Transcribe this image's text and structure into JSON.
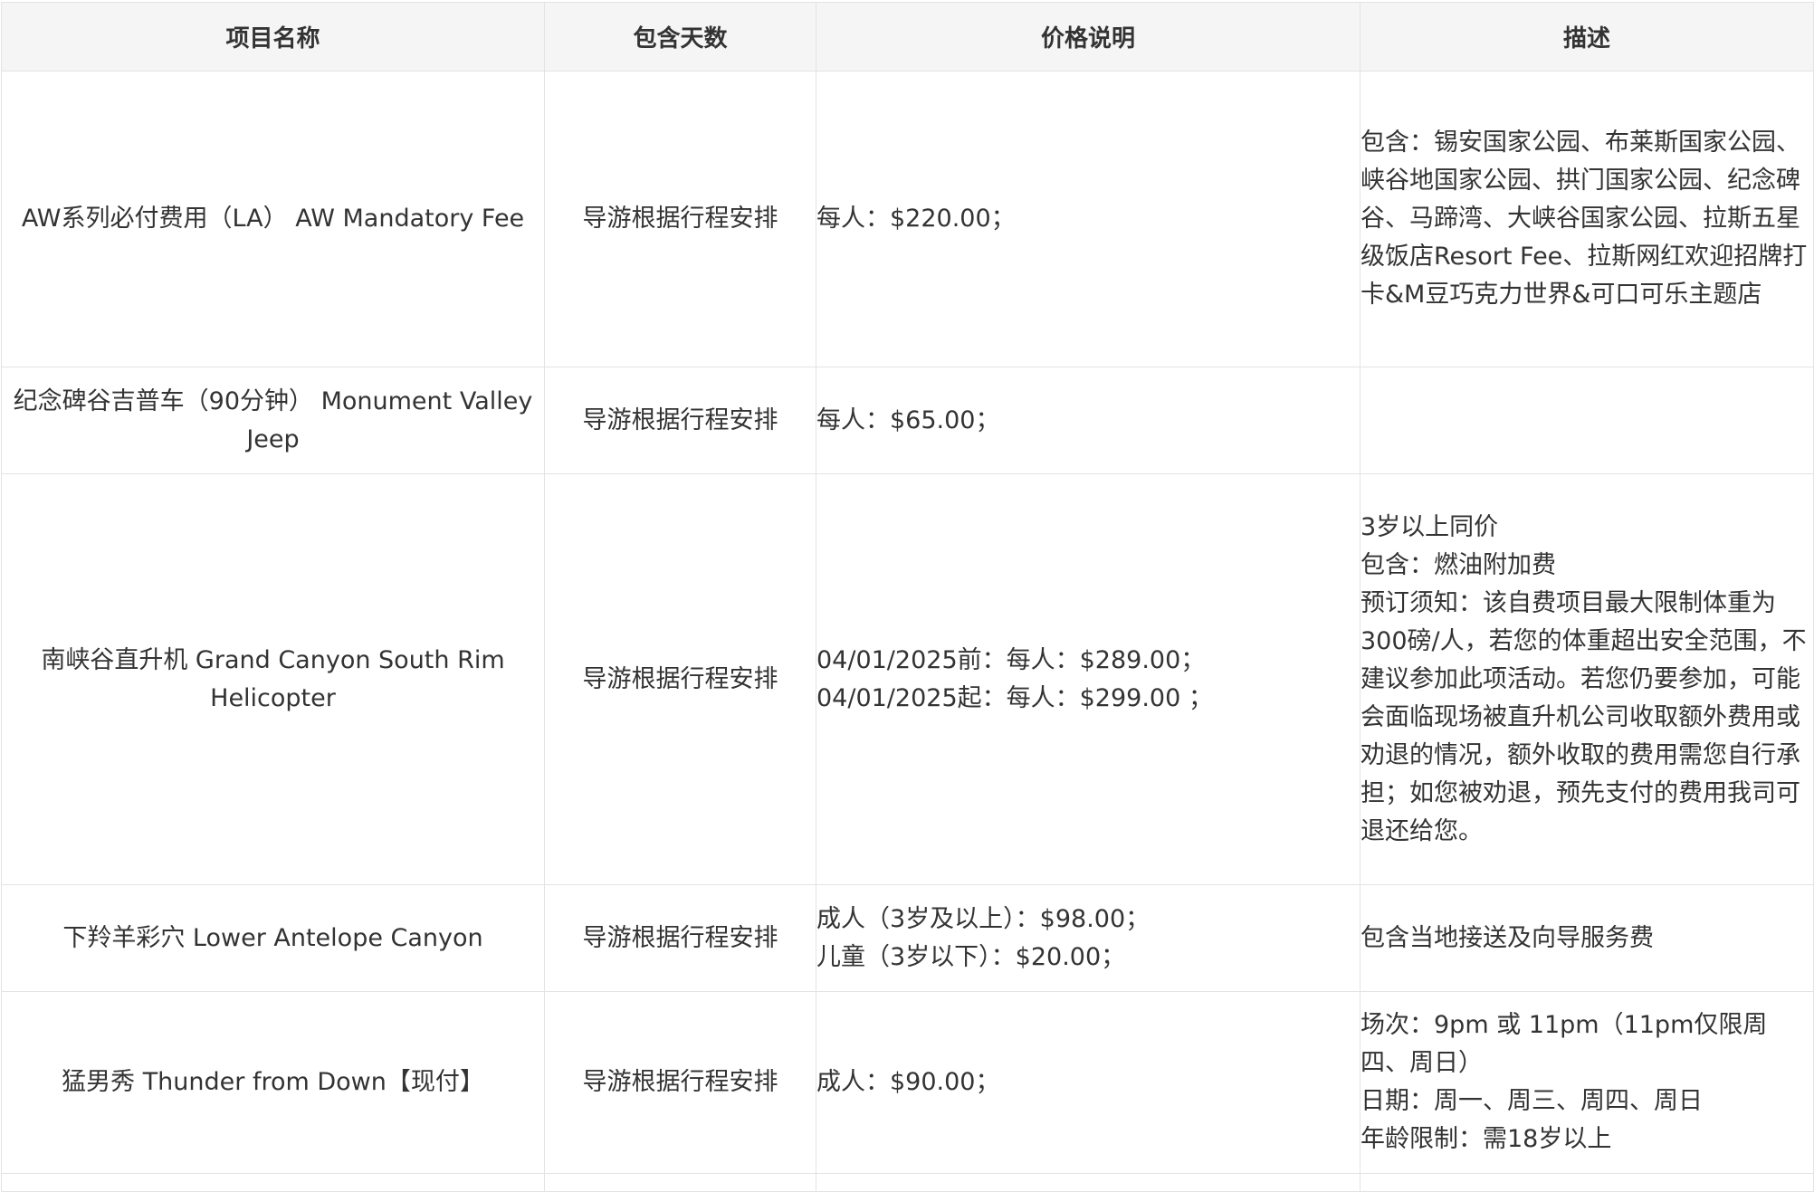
{
  "table": {
    "headers": [
      "项目名称",
      "包含天数",
      "价格说明",
      "描述"
    ],
    "rows": [
      {
        "name": "AW系列必付费用（LA） AW Mandatory Fee",
        "days": "导游根据行程安排",
        "price": [
          "每人：$220.00；"
        ],
        "desc": [
          "包含：锡安国家公园、布莱斯国家公园、峡谷地国家公园、拱门国家公园、纪念碑谷、马蹄湾、大峡谷国家公园、拉斯五星级饭店Resort Fee、拉斯网红欢迎招牌打卡&M豆巧克力世界&可口可乐主题店"
        ]
      },
      {
        "name": "纪念碑谷吉普车（90分钟） Monument Valley Jeep",
        "days": "导游根据行程安排",
        "price": [
          "每人：$65.00；"
        ],
        "desc": []
      },
      {
        "name": "南峡谷直升机 Grand Canyon South Rim Helicopter",
        "days": "导游根据行程安排",
        "price": [
          "04/01/2025前：每人：$289.00；",
          "04/01/2025起：每人：$299.00 ；"
        ],
        "desc": [
          "3岁以上同价",
          "包含：燃油附加费",
          "预订须知：该自费项目最大限制体重为300磅/人，若您的体重超出安全范围，不建议参加此项活动。若您仍要参加，可能会面临现场被直升机公司收取额外费用或劝退的情况，额外收取的费用需您自行承担；如您被劝退，预先支付的费用我司可退还给您。"
        ]
      },
      {
        "name": "下羚羊彩穴 Lower Antelope Canyon",
        "days": "导游根据行程安排",
        "price": [
          "成人（3岁及以上）：$98.00；",
          "儿童（3岁以下）：$20.00；"
        ],
        "desc": [
          "包含当地接送及向导服务费"
        ]
      },
      {
        "name": "猛男秀 Thunder from Down【现付】",
        "days": "导游根据行程安排",
        "price": [
          "成人：$90.00；"
        ],
        "desc": [
          "场次：9pm 或 11pm（11pm仅限周四、周日）",
          "日期：周一、周三、周四、周日",
          "年龄限制：需18岁以上"
        ]
      }
    ]
  }
}
